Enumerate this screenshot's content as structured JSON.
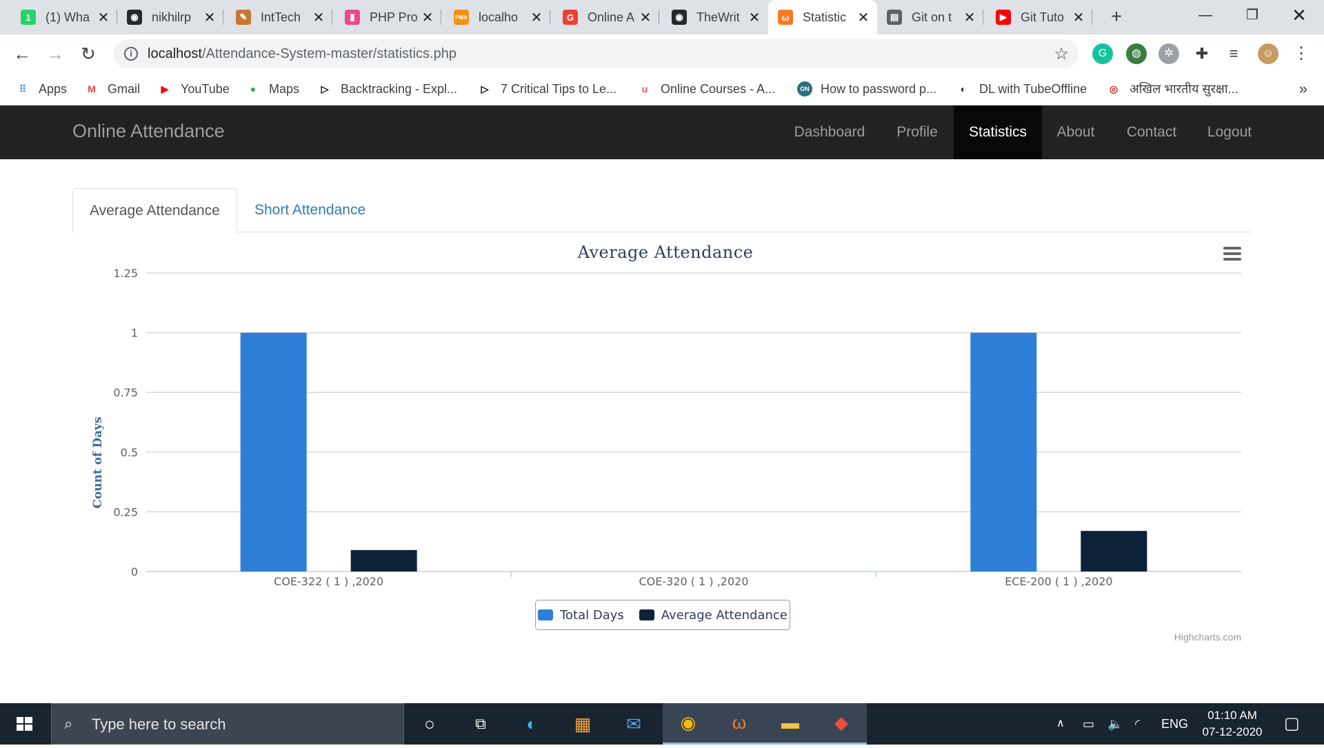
{
  "browser": {
    "tabs": [
      {
        "label": "(1) Wha",
        "icon": "whatsapp-icon",
        "color": "#25d366",
        "glyph": "1"
      },
      {
        "label": "nikhilrp",
        "icon": "github-icon",
        "color": "#24292e",
        "glyph": "◉"
      },
      {
        "label": "IntTech",
        "icon": "site-icon",
        "color": "#c87533",
        "glyph": "✎"
      },
      {
        "label": "PHP Pro",
        "icon": "book-icon",
        "color": "#e94b8a",
        "glyph": "▮"
      },
      {
        "label": "localho",
        "icon": "phpmyadmin-icon",
        "color": "#f29111",
        "glyph": "PMA"
      },
      {
        "label": "Online A",
        "icon": "google-icon",
        "color": "#ea4335",
        "glyph": "G"
      },
      {
        "label": "TheWrit",
        "icon": "github-icon",
        "color": "#24292e",
        "glyph": "◉"
      },
      {
        "label": "Statistic",
        "icon": "xampp-icon",
        "color": "#fb7a24",
        "glyph": "ω"
      },
      {
        "label": "Git on t",
        "icon": "document-icon",
        "color": "#5f6368",
        "glyph": "▤"
      },
      {
        "label": "Git Tuto",
        "icon": "youtube-icon",
        "color": "#ff0000",
        "glyph": "▶"
      }
    ],
    "active_tab_index": 7,
    "address": {
      "host": "localhost",
      "path": "/Attendance-System-master/statistics.php"
    },
    "bookmarks": [
      {
        "label": "Apps",
        "icon": "apps-grid-icon",
        "color": "#4285f4",
        "glyph": "⠿"
      },
      {
        "label": "Gmail",
        "icon": "gmail-icon",
        "color": "#ea4335",
        "glyph": "M"
      },
      {
        "label": "YouTube",
        "icon": "youtube-icon",
        "color": "#ff0000",
        "glyph": "▶"
      },
      {
        "label": "Maps",
        "icon": "maps-pin-icon",
        "color": "#34a853",
        "glyph": "●"
      },
      {
        "label": "Backtracking - Expl...",
        "icon": "play-icon",
        "color": "#000000",
        "glyph": "▷"
      },
      {
        "label": "7 Critical Tips to Le...",
        "icon": "play-icon",
        "color": "#000000",
        "glyph": "▷"
      },
      {
        "label": "Online Courses - A...",
        "icon": "udemy-icon",
        "color": "#ec5252",
        "glyph": "u"
      },
      {
        "label": "How to password p...",
        "icon": "on-icon",
        "color": "#2a6f7c",
        "glyph": "ON"
      },
      {
        "label": "DL with TubeOffline",
        "icon": "globe-icon",
        "color": "#222222",
        "glyph": "◐"
      },
      {
        "label": "अखिल भारतीय सुरक्षा...",
        "icon": "emblem-icon",
        "color": "#d93025",
        "glyph": "◎"
      }
    ]
  },
  "site": {
    "brand": "Online Attendance",
    "nav": [
      "Dashboard",
      "Profile",
      "Statistics",
      "About",
      "Contact",
      "Logout"
    ],
    "active_nav": "Statistics"
  },
  "tabs": {
    "average": "Average Attendance",
    "short": "Short Attendance"
  },
  "chart_data": {
    "type": "bar",
    "title": "Average Attendance",
    "xlabel": "",
    "ylabel": "Count of Days",
    "ylim": [
      0,
      1.25
    ],
    "yticks": [
      "0",
      "0.25",
      "0.5",
      "0.75",
      "1",
      "1.25"
    ],
    "categories": [
      "COE-322 ( 1 ) ,2020",
      "COE-320 ( 1 ) ,2020",
      "ECE-200 ( 1 ) ,2020"
    ],
    "series": [
      {
        "name": "Total Days",
        "color": "#2f7ed8",
        "values": [
          1,
          0,
          1
        ]
      },
      {
        "name": "Average Attendance",
        "color": "#0d233a",
        "values": [
          0.09,
          0,
          0.17
        ]
      }
    ],
    "legend": "bottom-center",
    "grid": true,
    "credit": "Highcharts.com"
  },
  "taskbar": {
    "search_placeholder": "Type here to search",
    "language": "ENG",
    "time": "01:10 AM",
    "date": "07-12-2020"
  }
}
